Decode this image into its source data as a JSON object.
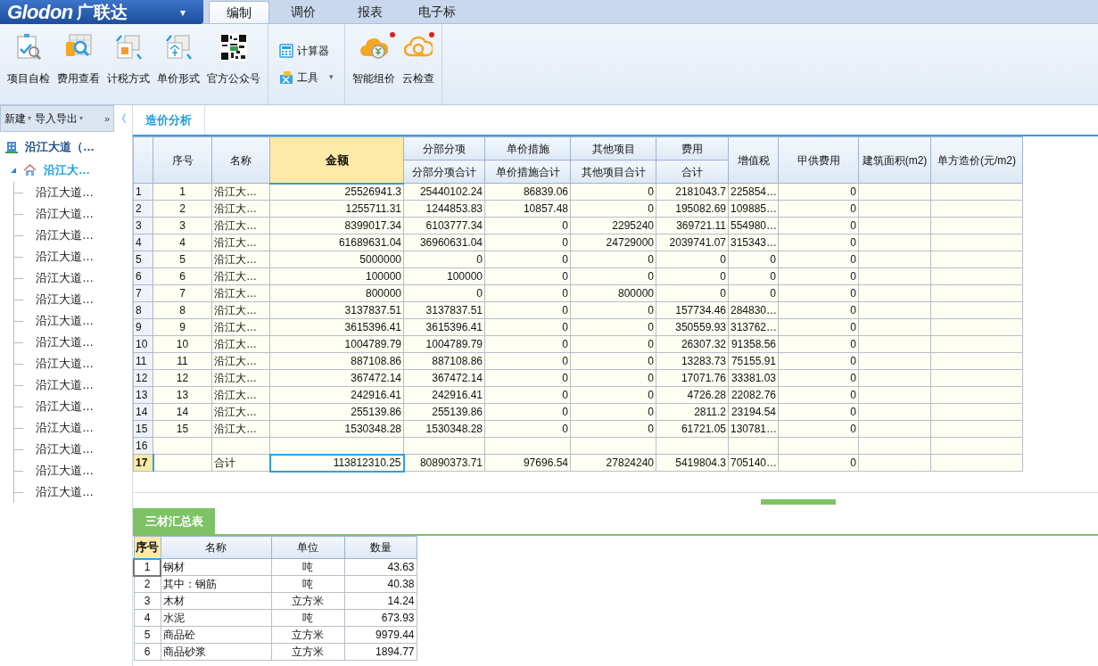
{
  "app": {
    "logo": "Glodon",
    "logo_cn": "广联达",
    "menu_caret": "▾"
  },
  "menu_tabs": [
    {
      "label": "编制",
      "selected": true
    },
    {
      "label": "调价",
      "selected": false
    },
    {
      "label": "报表",
      "selected": false
    },
    {
      "label": "电子标",
      "selected": false
    }
  ],
  "ribbon": [
    {
      "items": [
        {
          "kind": "check",
          "label": "项目自检",
          "badge": false
        },
        {
          "kind": "fees",
          "label": "费用查看",
          "badge": false
        },
        {
          "kind": "tax",
          "label": "计税方式",
          "badge": false
        },
        {
          "kind": "price",
          "label": "单价形式",
          "badge": false
        },
        {
          "kind": "qr",
          "label": "官方公众号",
          "badge": false
        }
      ]
    },
    {
      "items": [
        {
          "kind": "calculator",
          "label": "计算器"
        },
        {
          "kind": "tools",
          "label": "工具",
          "caret": "▾"
        }
      ]
    },
    {
      "items": [
        {
          "kind": "cloud-price",
          "label": "智能组价",
          "badge": true
        },
        {
          "kind": "cloud-check",
          "label": "云检查",
          "badge": true
        }
      ]
    }
  ],
  "sidebar": {
    "toolbar": [
      {
        "label": "新建",
        "caret": "▾"
      },
      {
        "label": "导入导出",
        "caret": "▾"
      }
    ],
    "more": "»",
    "collapse": "《",
    "tree": [
      {
        "label": "沿江大道（…",
        "kind": "project",
        "children": [
          {
            "label": "沿江大…",
            "kind": "unit",
            "expanded": true,
            "selected": true,
            "children": [
              {
                "label": "沿江大道…"
              },
              {
                "label": "沿江大道…"
              },
              {
                "label": "沿江大道…"
              },
              {
                "label": "沿江大道…"
              },
              {
                "label": "沿江大道…"
              },
              {
                "label": "沿江大道…"
              },
              {
                "label": "沿江大道…"
              },
              {
                "label": "沿江大道…"
              },
              {
                "label": "沿江大道…"
              },
              {
                "label": "沿江大道…"
              },
              {
                "label": "沿江大道…"
              },
              {
                "label": "沿江大道…"
              },
              {
                "label": "沿江大道…"
              },
              {
                "label": "沿江大道…"
              },
              {
                "label": "沿江大道…"
              }
            ]
          }
        ]
      }
    ]
  },
  "main_tabs": [
    {
      "label": "造价分析",
      "selected": true
    }
  ],
  "table": {
    "columns": [
      {
        "label": "序号",
        "selected": false
      },
      {
        "label": "名称",
        "selected": false
      },
      {
        "label": "金额",
        "selected": true
      },
      {
        "label": "分部分项",
        "sub": "分部分项合计",
        "selected": false
      },
      {
        "label": "单价措施",
        "sub": "单价措施合计",
        "selected": false
      },
      {
        "label": "其他项目",
        "sub": "其他项目合计",
        "selected": false
      },
      {
        "label": "费用",
        "sub": "合计",
        "selected": false
      },
      {
        "label": "增值税",
        "selected": false
      },
      {
        "label": "甲供费用",
        "selected": false
      },
      {
        "label": "建筑面积(m2)",
        "selected": false
      },
      {
        "label": "单方造价(元/m2)",
        "selected": false
      }
    ],
    "rows": [
      {
        "row": "1",
        "selected": false,
        "cells": [
          "1",
          "沿江大…",
          "25526941.3",
          "25440102.24",
          "86839.06",
          "0",
          "2181043.7",
          "225854…",
          "0"
        ]
      },
      {
        "row": "2",
        "selected": false,
        "cells": [
          "2",
          "沿江大…",
          "1255711.31",
          "1244853.83",
          "10857.48",
          "0",
          "195082.69",
          "109885…",
          "0"
        ]
      },
      {
        "row": "3",
        "selected": false,
        "cells": [
          "3",
          "沿江大…",
          "8399017.34",
          "6103777.34",
          "0",
          "2295240",
          "369721.11",
          "554980…",
          "0"
        ]
      },
      {
        "row": "4",
        "selected": false,
        "cells": [
          "4",
          "沿江大…",
          "61689631.04",
          "36960631.04",
          "0",
          "24729000",
          "2039741.07",
          "315343…",
          "0"
        ]
      },
      {
        "row": "5",
        "selected": false,
        "cells": [
          "5",
          "沿江大…",
          "5000000",
          "0",
          "0",
          "0",
          "0",
          "0",
          "0"
        ]
      },
      {
        "row": "6",
        "selected": false,
        "cells": [
          "6",
          "沿江大…",
          "100000",
          "100000",
          "0",
          "0",
          "0",
          "0",
          "0"
        ]
      },
      {
        "row": "7",
        "selected": false,
        "cells": [
          "7",
          "沿江大…",
          "800000",
          "0",
          "0",
          "800000",
          "0",
          "0",
          "0"
        ]
      },
      {
        "row": "8",
        "selected": false,
        "cells": [
          "8",
          "沿江大…",
          "3137837.51",
          "3137837.51",
          "0",
          "0",
          "157734.46",
          "284830…",
          "0"
        ]
      },
      {
        "row": "9",
        "selected": false,
        "cells": [
          "9",
          "沿江大…",
          "3615396.41",
          "3615396.41",
          "0",
          "0",
          "350559.93",
          "313762…",
          "0"
        ]
      },
      {
        "row": "10",
        "selected": false,
        "cells": [
          "10",
          "沿江大…",
          "1004789.79",
          "1004789.79",
          "0",
          "0",
          "26307.32",
          "91358.56",
          "0"
        ]
      },
      {
        "row": "11",
        "selected": false,
        "cells": [
          "11",
          "沿江大…",
          "887108.86",
          "887108.86",
          "0",
          "0",
          "13283.73",
          "75155.91",
          "0"
        ]
      },
      {
        "row": "12",
        "selected": false,
        "cells": [
          "12",
          "沿江大…",
          "367472.14",
          "367472.14",
          "0",
          "0",
          "17071.76",
          "33381.03",
          "0"
        ]
      },
      {
        "row": "13",
        "selected": false,
        "cells": [
          "13",
          "沿江大…",
          "242916.41",
          "242916.41",
          "0",
          "0",
          "4726.28",
          "22082.76",
          "0"
        ]
      },
      {
        "row": "14",
        "selected": false,
        "cells": [
          "14",
          "沿江大…",
          "255139.86",
          "255139.86",
          "0",
          "0",
          "2811.2",
          "23194.54",
          "0"
        ]
      },
      {
        "row": "15",
        "selected": false,
        "cells": [
          "15",
          "沿江大…",
          "1530348.28",
          "1530348.28",
          "0",
          "0",
          "61721.05",
          "130781…",
          "0"
        ]
      },
      {
        "row": "16",
        "selected": false,
        "cells": []
      },
      {
        "row": "17",
        "selected": true,
        "cells": [
          null,
          "合计",
          "113812310.25",
          "80890373.71",
          "97696.54",
          "27824240",
          "5419804.3",
          "705140…",
          "0"
        ]
      }
    ]
  },
  "bottom_tabs": [
    {
      "label": "三材汇总表",
      "selected": true
    }
  ],
  "materials": {
    "columns": [
      {
        "label": "序号",
        "selected": true
      },
      {
        "label": "名称",
        "selected": false
      },
      {
        "label": "单位",
        "selected": false
      },
      {
        "label": "数量",
        "selected": false
      }
    ],
    "rows": [
      {
        "cells": [
          "1",
          "钢材",
          "吨",
          "43.63"
        ],
        "selected": true
      },
      {
        "cells": [
          "2",
          "其中：钢筋",
          "吨",
          "40.38"
        ],
        "selected": false
      },
      {
        "cells": [
          "3",
          "木材",
          "立方米",
          "14.24"
        ],
        "selected": false
      },
      {
        "cells": [
          "4",
          "水泥",
          "吨",
          "673.93"
        ],
        "selected": false
      },
      {
        "cells": [
          "5",
          "商品砼",
          "立方米",
          "9979.44"
        ],
        "selected": false
      },
      {
        "cells": [
          "6",
          "商品砂浆",
          "立方米",
          "1894.77"
        ],
        "selected": false
      }
    ]
  }
}
